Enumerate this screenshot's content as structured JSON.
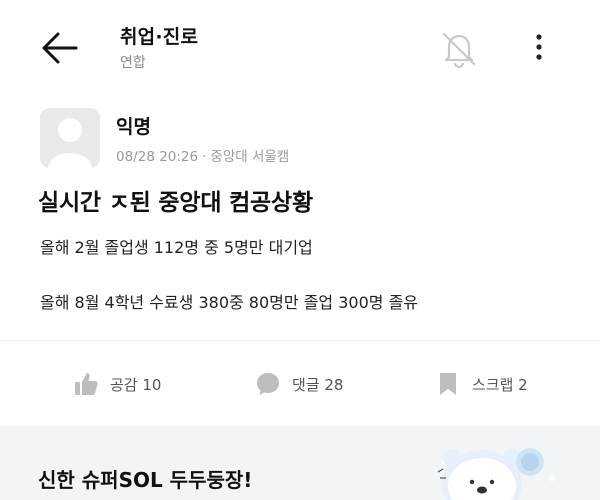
{
  "header": {
    "board_title": "취업·진로",
    "board_sub": "연합",
    "icons": {
      "back": "arrow-left-icon",
      "notify": "bell-off-icon",
      "more": "more-vertical-icon"
    }
  },
  "post": {
    "author": "익명",
    "date": "08/28 20:26",
    "separator": "·",
    "school": "중앙대 서울캠",
    "title": "실시간 ㅈ된 중앙대 컴공상황",
    "body": [
      "올해 2월 졸업생 112명 중 5명만 대기업",
      "올해 8월 4학년 수료생 380중 80명만 졸업 300명 졸유"
    ]
  },
  "actions": {
    "like": {
      "label": "공감 10",
      "icon": "thumbs-up-icon"
    },
    "comment": {
      "label": "댓글 28",
      "icon": "comment-bubble-icon"
    },
    "scrap": {
      "label": "스크랩 2",
      "icon": "bookmark-icon"
    }
  },
  "ad": {
    "text": "신한 슈퍼SOL 두두둥장!"
  },
  "colors": {
    "text": "#111111",
    "muted": "#9a9a9a",
    "icon_gray": "#c4c4c4",
    "ad_bg": "#f3f4f6"
  }
}
